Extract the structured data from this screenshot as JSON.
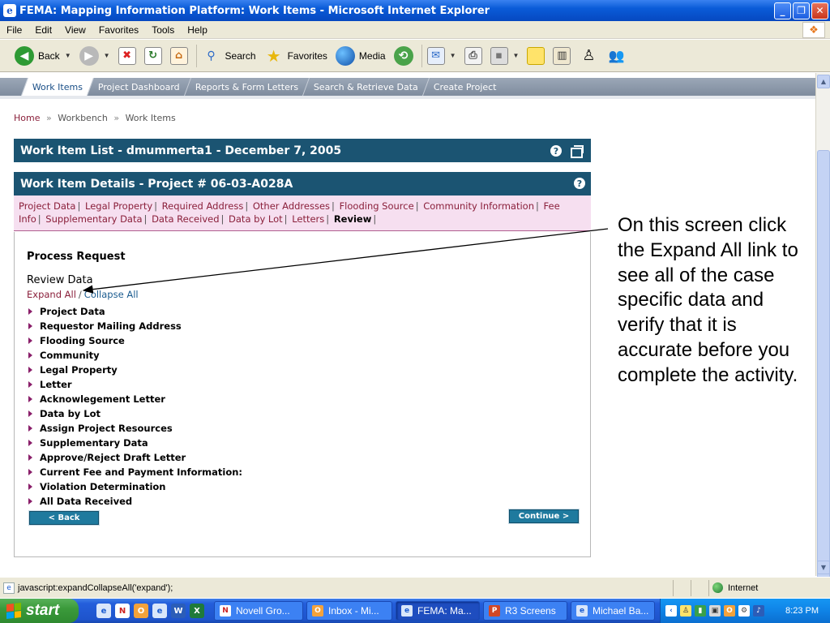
{
  "window": {
    "title": "FEMA: Mapping Information Platform: Work Items - Microsoft Internet Explorer",
    "minimize": "_",
    "maximize": "❐",
    "close": "✕"
  },
  "menu": [
    "File",
    "Edit",
    "View",
    "Favorites",
    "Tools",
    "Help"
  ],
  "toolbar": {
    "back": "Back",
    "search": "Search",
    "favorites": "Favorites",
    "media": "Media"
  },
  "nav_tabs": [
    "Work Items",
    "Project Dashboard",
    "Reports & Form Letters",
    "Search & Retrieve Data",
    "Create Project"
  ],
  "breadcrumb": {
    "home": "Home",
    "sep": "»",
    "level2": "Workbench",
    "level3": "Work Items"
  },
  "work_item_list": {
    "title": "Work Item List - dmummerta1 - December 7, 2005"
  },
  "work_item_details": {
    "title": "Work Item Details - Project # 06-03-A028A"
  },
  "sub_nav": [
    "Project Data",
    "Legal Property",
    "Required Address",
    "Other Addresses",
    "Flooding Source",
    "Community Information",
    "Fee Info",
    "Supplementary Data",
    "Data Received",
    "Data by Lot",
    "Letters",
    "Review"
  ],
  "sub_nav_current": "Review",
  "process_title": "Process Request",
  "review_title": "Review Data",
  "expand_all": "Expand All",
  "collapse_all": "Collapse All",
  "sections": [
    "Project Data",
    "Requestor Mailing Address",
    "Flooding Source",
    "Community",
    "Legal Property",
    "Letter",
    "Acknowlegement Letter",
    "Data by Lot",
    "Assign Project Resources",
    "Supplementary Data",
    "Approve/Reject Draft Letter",
    "Current Fee and Payment Information:",
    "Violation Determination",
    "All Data Received"
  ],
  "back_button": "< Back",
  "continue_button": "Continue >",
  "annotation": "On this screen click the Expand All link to see all of the case specific data and verify that it is accurate before you complete the activity.",
  "status": {
    "text": "javascript:expandCollapseAll('expand');",
    "zone": "Internet"
  },
  "taskbar": {
    "start": "start",
    "tasks": [
      "Novell Gro...",
      "Inbox - Mi...",
      "FEMA: Ma...",
      "R3 Screens",
      "Michael Ba..."
    ],
    "active_task": "FEMA: Ma...",
    "clock": "8:23 PM"
  },
  "colors": {
    "panel_header": "#1b5472",
    "link": "#8a1f3a",
    "subnav_bg": "#f6dff0",
    "button": "#1f7a9e"
  }
}
